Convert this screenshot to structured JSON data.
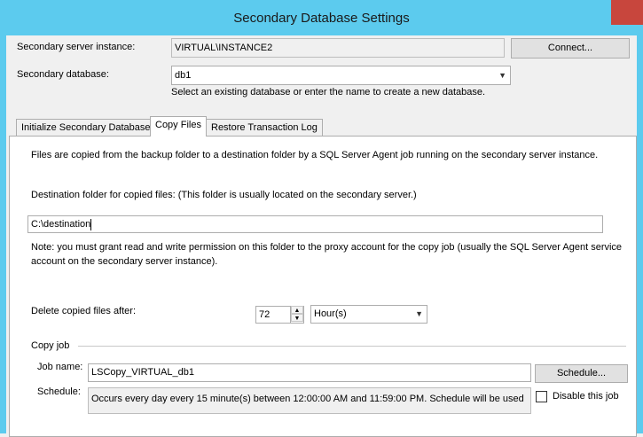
{
  "window": {
    "title": "Secondary Database Settings"
  },
  "server": {
    "label": "Secondary server instance:",
    "value": "VIRTUAL\\INSTANCE2",
    "connect_button": "Connect..."
  },
  "database": {
    "label": "Secondary database:",
    "value": "db1",
    "hint": "Select an existing database or enter the name to create a new database."
  },
  "tabs": [
    {
      "label": "Initialize Secondary Database",
      "selected": false
    },
    {
      "label": "Copy Files",
      "selected": true
    },
    {
      "label": "Restore Transaction Log",
      "selected": false
    }
  ],
  "copy_files": {
    "intro": "Files are copied from the backup folder to a destination folder by a SQL Server Agent job running on the secondary server instance.",
    "destination_label": "Destination folder for copied files: (This folder is usually located on the secondary server.)",
    "destination_value": "C:\\destination",
    "note_line1": "Note: you must grant read and write permission on this folder to the proxy account for the copy job (usually the SQL Server Agent service",
    "note_line2": "account on the secondary server instance).",
    "delete_label": "Delete copied files after:",
    "delete_value": "72",
    "delete_unit": "Hour(s)",
    "copy_job_group": "Copy job",
    "job_name_label": "Job name:",
    "job_name_value": "LSCopy_VIRTUAL_db1",
    "schedule_button": "Schedule...",
    "schedule_label": "Schedule:",
    "schedule_value": "Occurs every day every 15 minute(s) between 12:00:00 AM and 11:59:00 PM. Schedule will be used",
    "disable_job_label": "Disable this job",
    "disable_job_checked": false
  }
}
